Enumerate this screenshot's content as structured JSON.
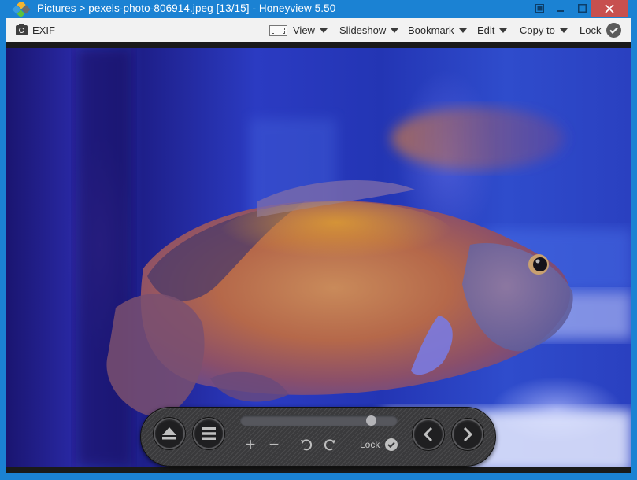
{
  "window": {
    "title": "Pictures > pexels-photo-806914.jpeg [13/15] - Honeyview 5.50",
    "app_name": "Honeyview 5.50",
    "breadcrumb_folder": "Pictures",
    "file_name": "pexels-photo-806914.jpeg",
    "position": "[13/15]",
    "buttons": {
      "fullscreen": "fullscreen-icon",
      "minimize": "minimize-icon",
      "maximize": "maximize-icon",
      "close": "close-icon"
    },
    "colors": {
      "titlebar": "#1b82d3",
      "close": "#c7504f"
    }
  },
  "toolbar": {
    "exif_label": "EXIF",
    "view_label": "View",
    "slideshow_label": "Slideshow",
    "bookmark_label": "Bookmark",
    "edit_label": "Edit",
    "copyto_label": "Copy to",
    "lock_label": "Lock"
  },
  "image": {
    "description": "Orange-spotted oscar cichlid fish swimming in a blue-lit aquarium"
  },
  "controls": {
    "eject_icon": "eject-icon",
    "menu_icon": "menu-icon",
    "position_fraction": 0.83,
    "zoom_in": "+",
    "zoom_out": "−",
    "rotate_left_icon": "rotate-left-icon",
    "rotate_right_icon": "rotate-right-icon",
    "lock_label": "Lock",
    "prev_icon": "chevron-left-icon",
    "next_icon": "chevron-right-icon"
  }
}
